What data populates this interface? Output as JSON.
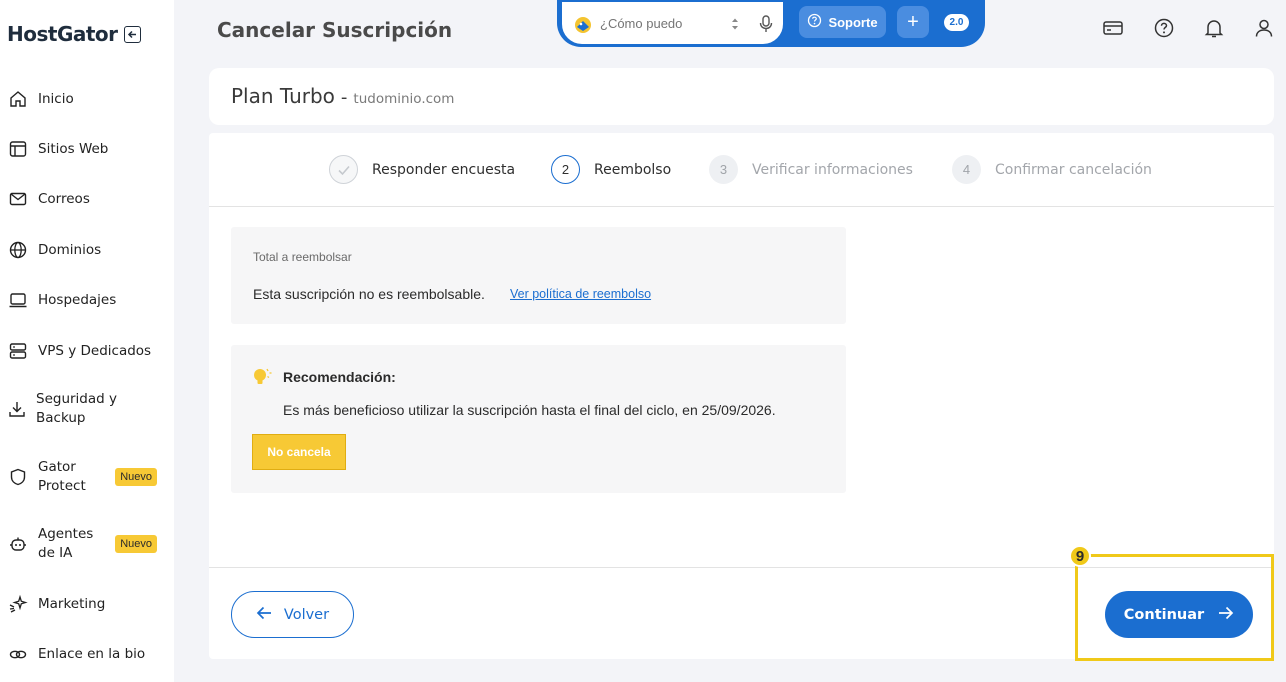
{
  "brand": {
    "name": "HostGator"
  },
  "sidebar": {
    "items": [
      {
        "label": "Inicio",
        "icon": "home-icon"
      },
      {
        "label": "Sitios Web",
        "icon": "browser-icon"
      },
      {
        "label": "Correos",
        "icon": "mail-icon"
      },
      {
        "label": "Dominios",
        "icon": "globe-icon"
      },
      {
        "label": "Hospedajes",
        "icon": "laptop-icon"
      },
      {
        "label": "VPS y Dedicados",
        "icon": "server-icon"
      },
      {
        "label": "Seguridad y Backup",
        "icon": "download-icon"
      },
      {
        "label": "Gator Protect",
        "icon": "shield-icon",
        "badge": "Nuevo"
      },
      {
        "label": "Agentes de IA",
        "icon": "robot-icon",
        "badge": "Nuevo"
      },
      {
        "label": "Marketing",
        "icon": "sparkle-icon"
      },
      {
        "label": "Enlace en la bio",
        "icon": "link-icon"
      }
    ]
  },
  "header": {
    "title": "Cancelar Suscripción",
    "search_placeholder": "¿Cómo puedo",
    "support_label": "Soporte",
    "version_label": "2.0"
  },
  "plan": {
    "name": "Plan Turbo",
    "separator": "-",
    "domain": "tudominio.com"
  },
  "steps": [
    {
      "number": "✓",
      "label": "Responder encuesta",
      "state": "done"
    },
    {
      "number": "2",
      "label": "Reembolso",
      "state": "active"
    },
    {
      "number": "3",
      "label": "Verificar informaciones",
      "state": "pending"
    },
    {
      "number": "4",
      "label": "Confirmar cancelación",
      "state": "pending"
    }
  ],
  "refund": {
    "title": "Total a reembolsar",
    "text": "Esta suscripción no es reembolsable.",
    "link": "Ver política de reembolso"
  },
  "recommendation": {
    "title": "Recomendación:",
    "text": "Es más beneficioso utilizar la suscripción hasta el final del ciclo, en 25/09/2026.",
    "button": "No cancela"
  },
  "footer": {
    "back_label": "Volver",
    "continue_label": "Continuar"
  },
  "annotation": {
    "number": "9"
  },
  "colors": {
    "primary": "#1b6ed0",
    "accent": "#f7c935",
    "highlight": "#f0c919"
  }
}
